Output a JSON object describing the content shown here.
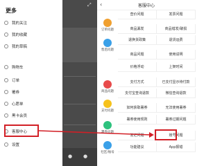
{
  "drawer": {
    "title": "更多",
    "items": [
      {
        "label": "我的关注",
        "icon": "heart-icon"
      },
      {
        "label": "我的收藏",
        "icon": "star-icon"
      },
      {
        "label": "我的草稿",
        "icon": "draft-icon"
      },
      {
        "label": "购物车",
        "icon": "cart-icon"
      },
      {
        "label": "订单",
        "icon": "order-icon"
      },
      {
        "label": "署券",
        "icon": "coupon-icon"
      },
      {
        "label": "心愿单",
        "icon": "wish-icon"
      },
      {
        "label": "黑卡会员",
        "icon": "vip-icon"
      },
      {
        "label": "客服中心",
        "icon": "service-icon"
      },
      {
        "label": "设置",
        "icon": "gear-icon"
      }
    ]
  },
  "cs": {
    "title": "客服中心",
    "back_icon": "back-icon",
    "categories": [
      {
        "label": "订单问题",
        "color": "#f0a030"
      },
      {
        "label": "售后问题",
        "color": "#3aa0e8"
      },
      {
        "label": "商品问题",
        "color": "#e84b4b"
      },
      {
        "label": "支付问题",
        "color": "#f6c21c"
      },
      {
        "label": "署券问题",
        "color": "#2ec27e"
      },
      {
        "label": "社区/账号",
        "color": "#3aa0e8"
      }
    ],
    "grid": [
      [
        "查价问题",
        "发票问题"
      ],
      [
        "商品漏发",
        "商品错发/破损"
      ],
      [
        "退换货政策",
        "退货运费"
      ],
      [
        "商品问题",
        "使用说明"
      ],
      [
        "价格浮动",
        "上架时间"
      ],
      [
        "支付方式",
        "已支付显示待付款"
      ],
      [
        "支付宝查询退款",
        "微信查询退款"
      ],
      [
        "如何获取署券",
        "无法使用署券"
      ],
      [
        "署券使用规则",
        "署券过期问题"
      ],
      [
        "发记问题",
        "账号问题"
      ],
      [
        "功能建议",
        "App报错"
      ]
    ]
  },
  "colors": {
    "highlight": "#d21f26"
  }
}
